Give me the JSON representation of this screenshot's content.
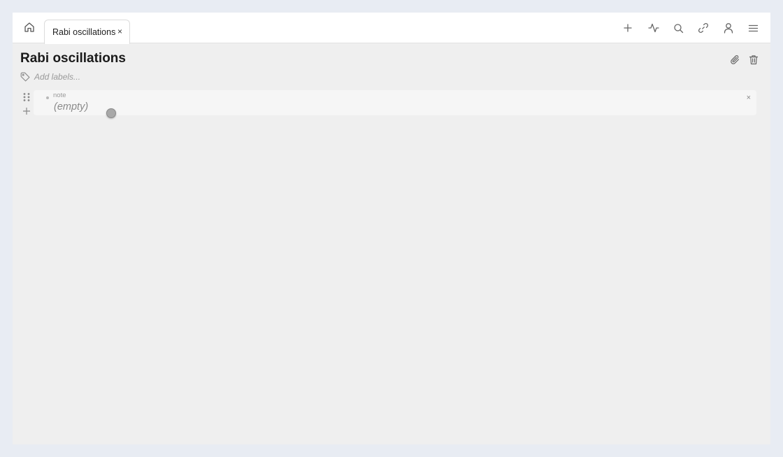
{
  "tabs": [
    {
      "label": "Rabi oscillations",
      "close": "×"
    }
  ],
  "note": {
    "title": "Rabi oscillations",
    "labels_placeholder": "Add labels...",
    "blocks": [
      {
        "type": "note",
        "content": "(empty)",
        "remove": "×"
      }
    ]
  },
  "toolbar": {
    "icons": [
      "plus-icon",
      "activity-icon",
      "search-icon",
      "link-icon",
      "user-icon",
      "menu-icon"
    ]
  },
  "colors": {
    "background": "#e8ecf3",
    "workspace": "#efefef",
    "topbar": "#ffffff",
    "icon": "#6b6b6b"
  }
}
